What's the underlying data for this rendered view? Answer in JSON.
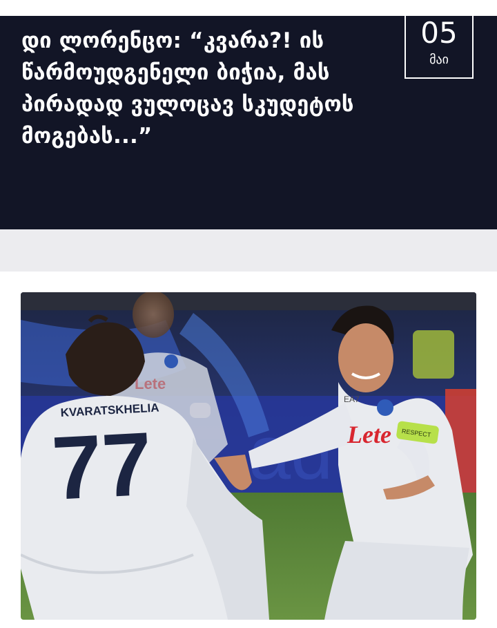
{
  "article": {
    "title": "დი ლორენცო: “კვარა?! ის წარმოუდგენელი ბიჭია, მას პირადად ვულოცავ სკუდეტოს მოგებას...”",
    "date": {
      "day": "05",
      "month": "მაი"
    },
    "image": {
      "jersey_name": "KVARATSKHELIA",
      "jersey_number": "77",
      "sponsor": "Lete",
      "sponsor_background": "lete",
      "kit_brand": "EA7",
      "captain_band": "RESPECT"
    }
  },
  "colors": {
    "header_background": "#121526",
    "separator": "#ececef",
    "pitch": "#5f8a3c",
    "stadium_blue": "#2a46a8",
    "jersey": "#e9ebef",
    "jersey_number": "#1c2542",
    "sponsor_red": "#d8262f",
    "captain_band": "#b7e04a"
  }
}
